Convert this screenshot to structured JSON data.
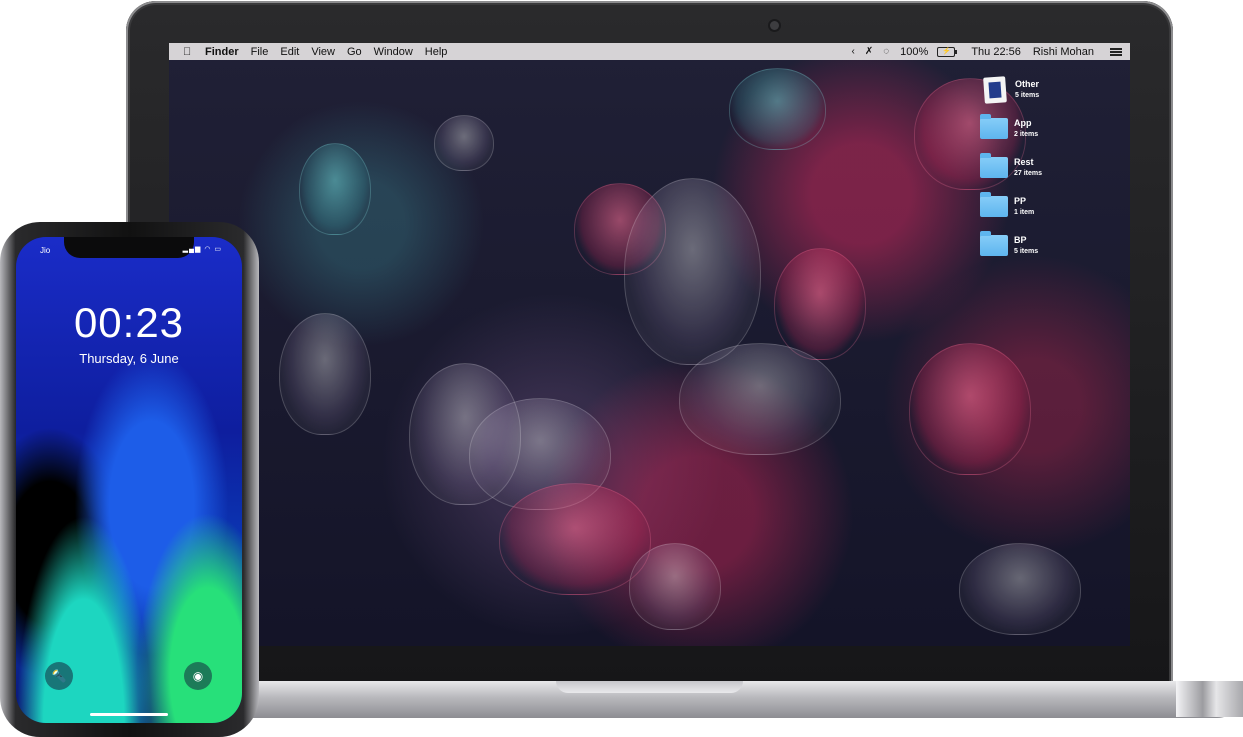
{
  "menubar": {
    "app_name": "Finder",
    "menus": [
      "File",
      "Edit",
      "View",
      "Go",
      "Window",
      "Help"
    ],
    "battery_percent": "100%",
    "battery_icon_text": "⚡",
    "clock": "Thu 22:56",
    "user_name": "Rishi Mohan",
    "icons": [
      "apple-icon",
      "chevron-left-icon",
      "bluetooth-icon",
      "wifi-icon",
      "battery-icon",
      "menu-list-icon"
    ]
  },
  "desktop": {
    "items": [
      {
        "name": "Other",
        "count": "5 items",
        "icon": "image-stack-icon"
      },
      {
        "name": "App",
        "count": "2 items",
        "icon": "folder-icon"
      },
      {
        "name": "Rest",
        "count": "27 items",
        "icon": "folder-icon"
      },
      {
        "name": "PP",
        "count": "1 item",
        "icon": "folder-icon"
      },
      {
        "name": "BP",
        "count": "5 items",
        "icon": "folder-icon"
      }
    ]
  },
  "phone": {
    "carrier": "Jio",
    "status_icons": "▂▄▆ ◠ ▭",
    "time": "00:23",
    "date": "Thursday, 6 June",
    "flashlight_glyph": "🔦",
    "camera_glyph": "◉"
  }
}
